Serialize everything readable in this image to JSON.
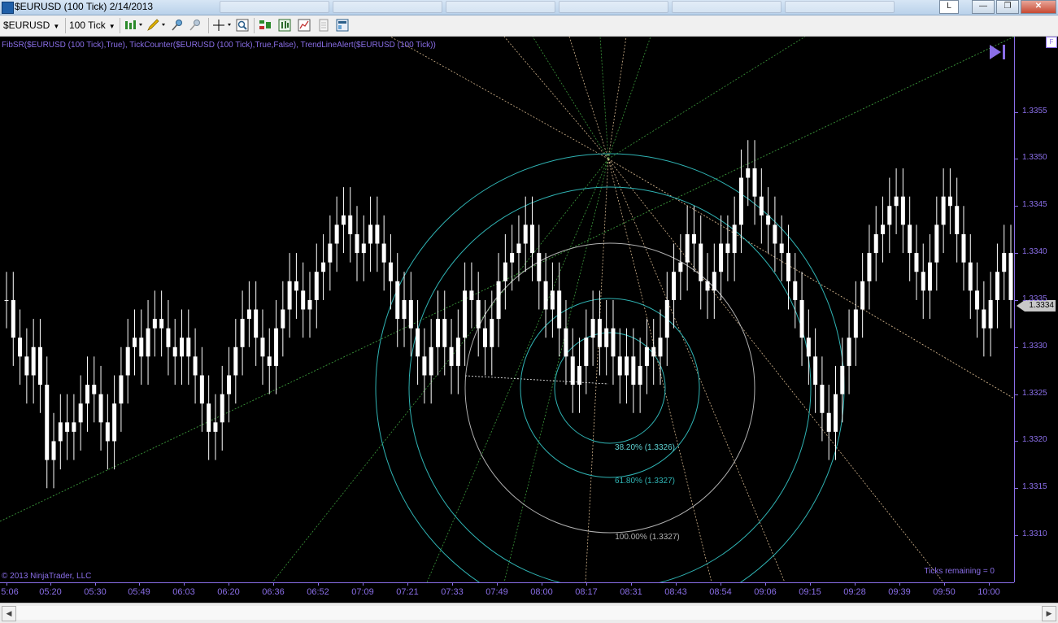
{
  "window": {
    "title": "$EURUSD (100 Tick)  2/14/2013",
    "buttons": {
      "layout": "L",
      "minimize": "—",
      "restore": "❐",
      "close": "✕"
    }
  },
  "toolbar": {
    "instrument": "$EURUSD",
    "interval": "100 Tick",
    "icons": [
      "bar-type-icon",
      "drawing-pencil-icon",
      "pin-icon",
      "remove-pin-icon",
      "crosshair-icon",
      "zoom-icon",
      "strategies-icon",
      "indicators-icon",
      "chart-properties-icon",
      "data-box-icon",
      "chart-trader-icon"
    ]
  },
  "chart": {
    "indicators_label": "FibSR($EURUSD (100 Tick),True), TickCounter($EURUSD (100 Tick),True,False), TrendLineAlert($EURUSD (100 Tick))",
    "copyright": "© 2013 NinjaTrader, LLC",
    "ticks_remaining": "Ticks remaining = 0",
    "fib_labels": [
      "38.20% (1.3326)",
      "61.80% (1.3327)",
      "100.00% (1.3327)"
    ],
    "current_price": "1.3334",
    "colors": {
      "background": "#000000",
      "bars": "#ffffff",
      "axis": "#8a6ee8",
      "circle_a": "#2fb3b3",
      "circle_b": "#b0b0b0",
      "fan": "#d2b48c",
      "trend": "#3c9a3c"
    }
  },
  "chart_data": {
    "type": "candlestick",
    "price_ticks": [
      "1.3355",
      "1.3350",
      "1.3345",
      "1.3340",
      "1.3335",
      "1.3330",
      "1.3325",
      "1.3320",
      "1.3315",
      "1.3310"
    ],
    "time_ticks": [
      "5:06",
      "05:20",
      "05:30",
      "05:49",
      "06:03",
      "06:20",
      "06:36",
      "06:52",
      "07:09",
      "07:21",
      "07:33",
      "07:49",
      "08:00",
      "08:17",
      "08:31",
      "08:43",
      "08:54",
      "09:06",
      "09:15",
      "09:28",
      "09:39",
      "09:50",
      "10:00"
    ],
    "ylim": [
      1.3305,
      1.3363
    ],
    "closes": [
      1.3335,
      1.3331,
      1.3329,
      1.3327,
      1.333,
      1.3326,
      1.3318,
      1.332,
      1.3322,
      1.3321,
      1.3322,
      1.3324,
      1.3326,
      1.3325,
      1.3322,
      1.332,
      1.3324,
      1.3327,
      1.333,
      1.3331,
      1.3329,
      1.3332,
      1.3333,
      1.3332,
      1.333,
      1.3329,
      1.3331,
      1.3329,
      1.3327,
      1.3324,
      1.3321,
      1.3322,
      1.3325,
      1.3327,
      1.333,
      1.3333,
      1.3334,
      1.3331,
      1.3329,
      1.3328,
      1.3332,
      1.3334,
      1.3337,
      1.3336,
      1.3334,
      1.3335,
      1.3338,
      1.3339,
      1.3341,
      1.3343,
      1.3344,
      1.3342,
      1.334,
      1.3341,
      1.3343,
      1.3341,
      1.3339,
      1.3337,
      1.3333,
      1.3335,
      1.3332,
      1.3329,
      1.3327,
      1.333,
      1.3333,
      1.333,
      1.3328,
      1.3331,
      1.3336,
      1.3335,
      1.3332,
      1.333,
      1.3333,
      1.3337,
      1.3339,
      1.334,
      1.3341,
      1.3343,
      1.334,
      1.3337,
      1.3334,
      1.3336,
      1.3332,
      1.3329,
      1.3326,
      1.3328,
      1.3331,
      1.3333,
      1.333,
      1.3332,
      1.3329,
      1.3327,
      1.3329,
      1.3326,
      1.3328,
      1.333,
      1.3329,
      1.3331,
      1.3335,
      1.3338,
      1.3339,
      1.3342,
      1.3341,
      1.3337,
      1.3336,
      1.3338,
      1.3341,
      1.334,
      1.3343,
      1.3348,
      1.3349,
      1.3346,
      1.3344,
      1.3343,
      1.3341,
      1.334,
      1.3337,
      1.3335,
      1.3331,
      1.3329,
      1.3326,
      1.3323,
      1.3321,
      1.3325,
      1.3328,
      1.3331,
      1.3334,
      1.3337,
      1.334,
      1.3342,
      1.3343,
      1.3345,
      1.3346,
      1.3343,
      1.334,
      1.3338,
      1.3336,
      1.3339,
      1.3343,
      1.3346,
      1.3345,
      1.3342,
      1.3339,
      1.3336,
      1.3334,
      1.3332,
      1.3335,
      1.3338,
      1.334,
      1.3335
    ]
  }
}
